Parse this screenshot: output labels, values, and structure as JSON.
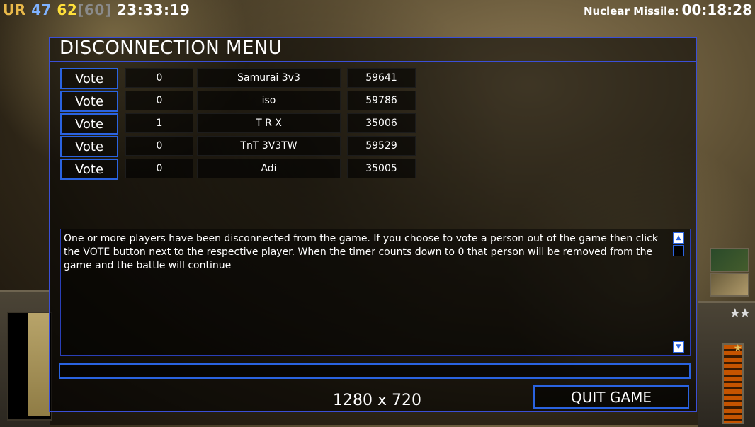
{
  "hud": {
    "faction": "UR",
    "num1": "47",
    "num2": "62",
    "num3": "[60]",
    "clock": "23:33:19",
    "superweapon_label": "Nuclear Missile:",
    "superweapon_time": "00:18:28"
  },
  "dialog": {
    "title": "DISCONNECTION MENU",
    "vote_label": "Vote",
    "players": [
      {
        "votes": "0",
        "name": "Samurai 3v3",
        "port": "59641"
      },
      {
        "votes": "0",
        "name": "iso",
        "port": "59786"
      },
      {
        "votes": "1",
        "name": "T R X",
        "port": "35006"
      },
      {
        "votes": "0",
        "name": "TnT 3V3TW",
        "port": "59529"
      },
      {
        "votes": "0",
        "name": "Adi",
        "port": "35005"
      }
    ],
    "info_text": "One or more players have been disconnected from the game. If you choose to vote a person out of the game then click the VOTE button next to the respective player. When the timer counts down to 0 that person will be removed from the game and the battle will continue",
    "chat_value": "",
    "quit_label": "QUIT GAME",
    "resolution": "1280 x 720"
  },
  "colors": {
    "accent_border": "#2a63e0",
    "faction": "#e9b94a",
    "stat_blue": "#7fb2ff",
    "stat_yellow": "#ffe03a"
  },
  "icons": {
    "scroll_up": "triangle-up-icon",
    "scroll_down": "triangle-down-icon",
    "rank": "stars-icon"
  }
}
